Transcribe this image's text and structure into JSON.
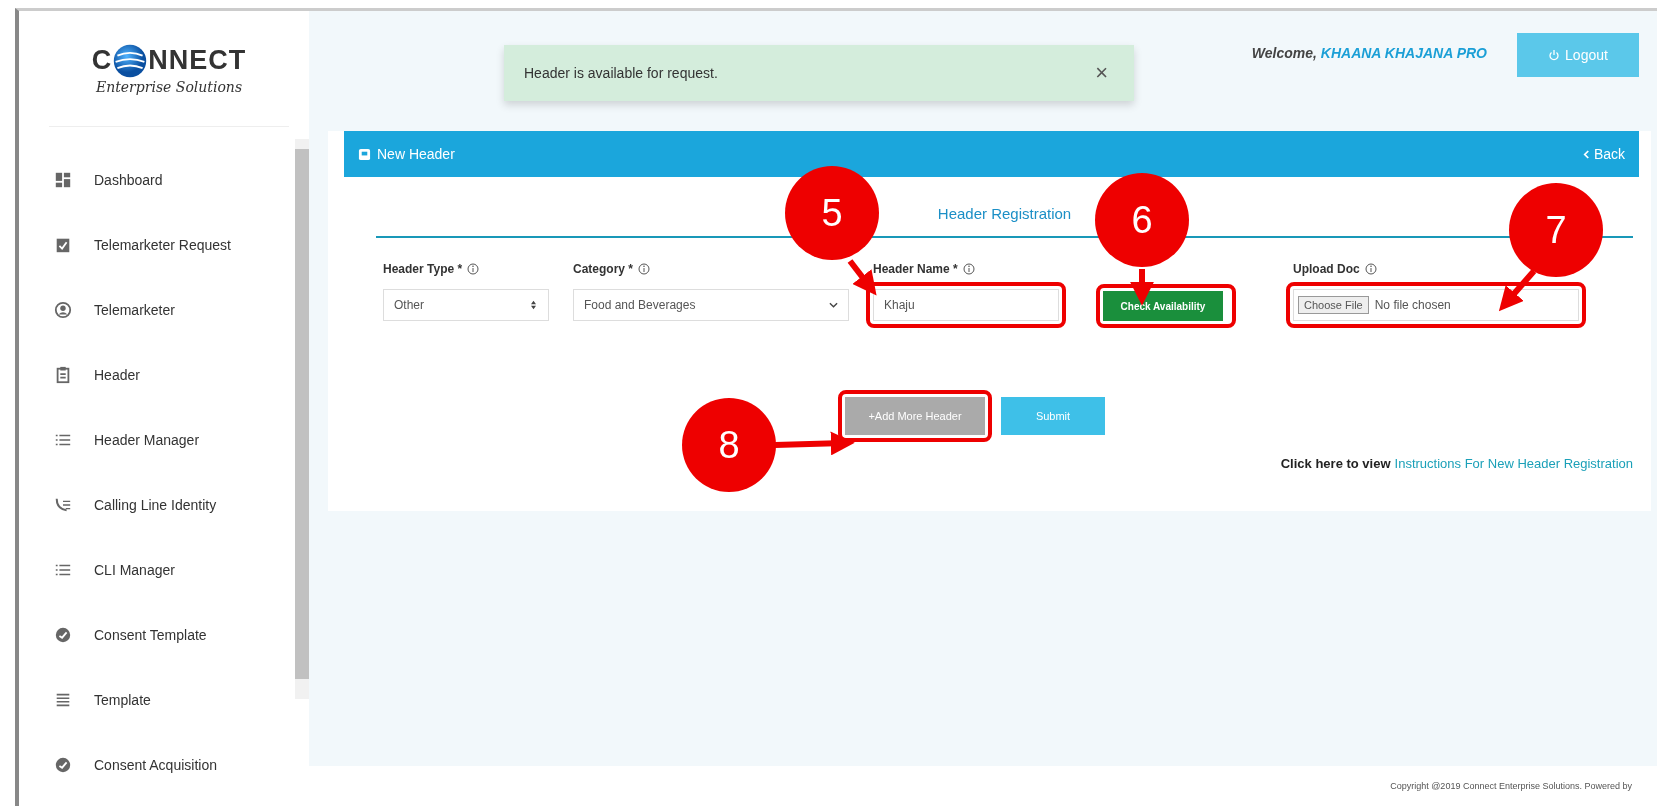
{
  "logo": {
    "wordmark_start": "C",
    "wordmark_end": "NNECT",
    "tagline": "Enterprise Solutions"
  },
  "sidebar": {
    "items": [
      {
        "label": "Dashboard",
        "kind": "dashboard"
      },
      {
        "label": "Telemarketer Request",
        "kind": "checklist"
      },
      {
        "label": "Telemarketer",
        "kind": "user"
      },
      {
        "label": "Header",
        "kind": "clipboard"
      },
      {
        "label": "Header Manager",
        "kind": "list"
      },
      {
        "label": "Calling Line Identity",
        "kind": "phone"
      },
      {
        "label": "CLI Manager",
        "kind": "list"
      },
      {
        "label": "Consent Template",
        "kind": "approval"
      },
      {
        "label": "Template",
        "kind": "lines"
      },
      {
        "label": "Consent Acquisition",
        "kind": "approval"
      }
    ]
  },
  "toast": {
    "message": "Header is available for request.",
    "close": "×"
  },
  "topbar": {
    "welcome": "Welcome,",
    "user": "KHAANA KHAJANA PRO",
    "logout": "Logout"
  },
  "panel": {
    "title": "New Header",
    "back": "Back"
  },
  "form": {
    "title": "Header Registration",
    "fields": [
      {
        "kind": "select",
        "label": "Header Type",
        "required": "*",
        "value": "Other",
        "highlighted": false
      },
      {
        "kind": "dropdown",
        "label": "Category",
        "required": "*",
        "value": "Food and Beverages",
        "highlighted": false
      },
      {
        "kind": "text",
        "label": "Header Name",
        "required": "*",
        "value": "Khaju",
        "highlighted": true
      },
      {
        "kind": "button",
        "text": "Check Availability",
        "highlighted": true
      },
      {
        "kind": "file",
        "label": "Upload Doc",
        "button": "Choose File",
        "value": "No file chosen",
        "highlighted": true
      }
    ],
    "buttons": [
      {
        "label": "+Add More Header",
        "kind": "secondary",
        "highlighted": true
      },
      {
        "label": "Submit",
        "kind": "primary",
        "highlighted": false
      }
    ],
    "instructions": {
      "prefix": "Click here to view",
      "link": "Instructions For New Header Registration"
    }
  },
  "annotations": [
    {
      "number": "5"
    },
    {
      "number": "6"
    },
    {
      "number": "7"
    },
    {
      "number": "8"
    }
  ],
  "footer": {
    "text": "Copyright @2019 Connect Enterprise Solutions. Powered by"
  }
}
